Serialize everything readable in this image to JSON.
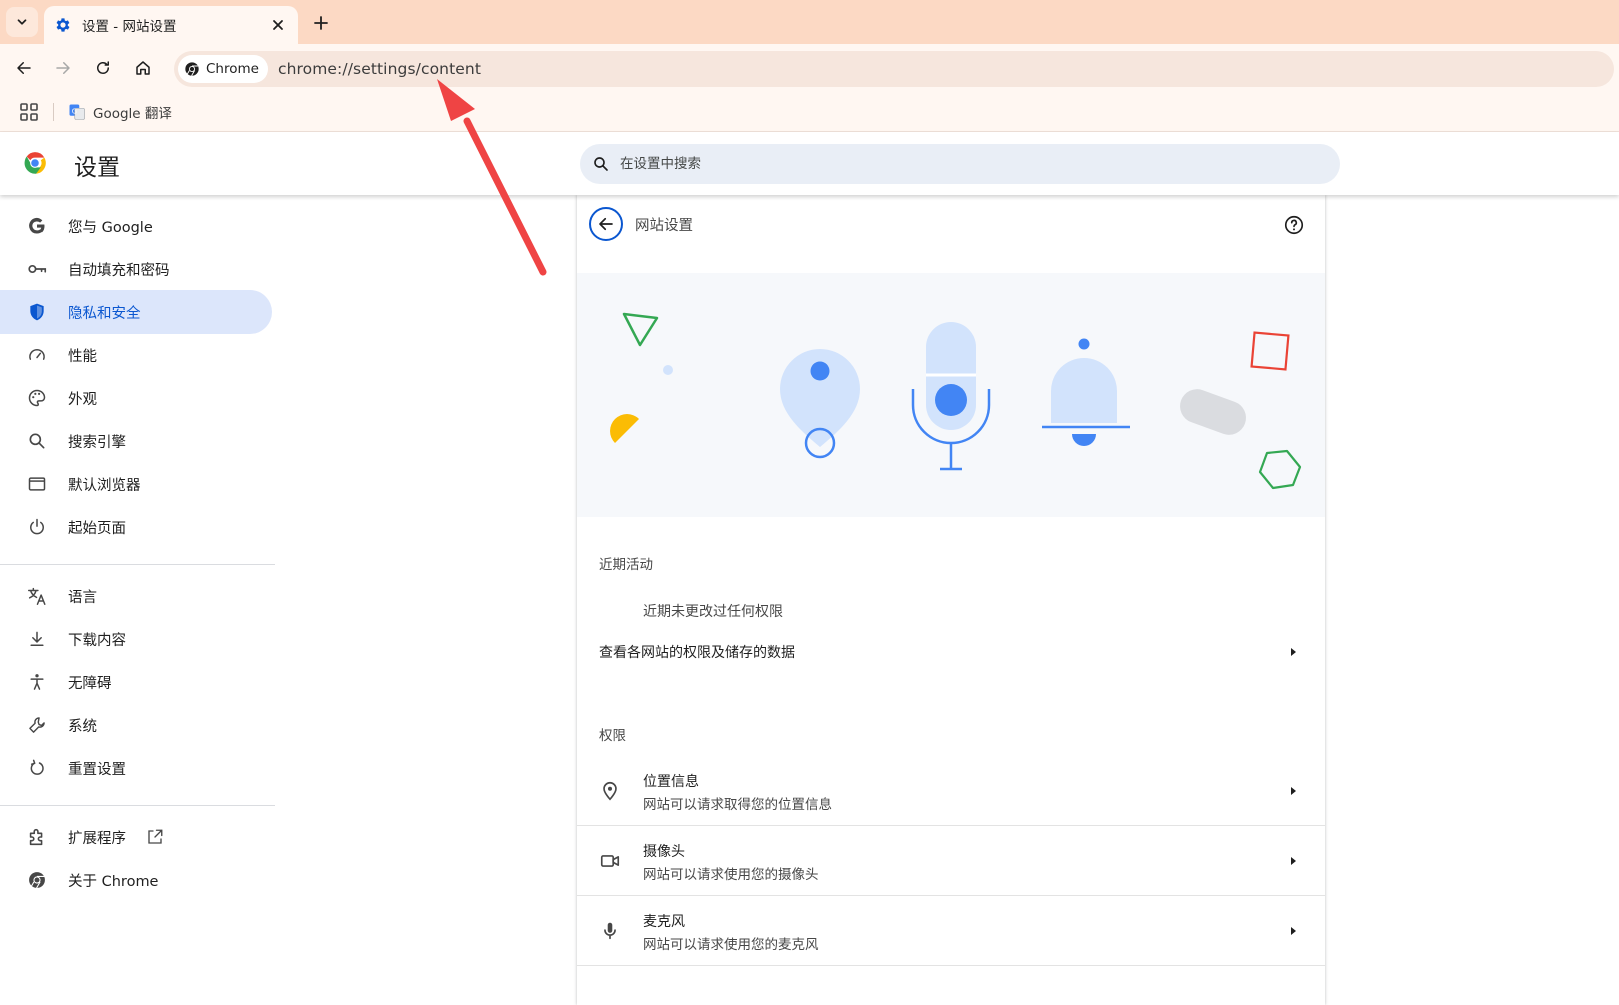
{
  "browser": {
    "tab": {
      "title": "设置 - 网站设置",
      "icon": "gear-icon"
    },
    "omnibox": {
      "chip_label": "Chrome",
      "url": "chrome://settings/content"
    },
    "bookmarks": [
      {
        "label": "Google 翻译",
        "icon": "google-translate-icon"
      }
    ]
  },
  "header": {
    "title": "设置",
    "search_placeholder": "在设置中搜索"
  },
  "sidebar": {
    "items": [
      {
        "label": "您与 Google",
        "icon": "google-g-icon"
      },
      {
        "label": "自动填充和密码",
        "icon": "key-icon"
      },
      {
        "label": "隐私和安全",
        "icon": "shield-icon",
        "active": true
      },
      {
        "label": "性能",
        "icon": "speedometer-icon"
      },
      {
        "label": "外观",
        "icon": "palette-icon"
      },
      {
        "label": "搜索引擎",
        "icon": "search-icon"
      },
      {
        "label": "默认浏览器",
        "icon": "browser-window-icon"
      },
      {
        "label": "起始页面",
        "icon": "power-icon"
      },
      {
        "label": "语言",
        "icon": "translate-icon"
      },
      {
        "label": "下载内容",
        "icon": "download-icon"
      },
      {
        "label": "无障碍",
        "icon": "accessibility-icon"
      },
      {
        "label": "系统",
        "icon": "wrench-icon"
      },
      {
        "label": "重置设置",
        "icon": "reset-icon"
      },
      {
        "label": "扩展程序",
        "icon": "puzzle-icon"
      },
      {
        "label": "关于 Chrome",
        "icon": "chrome-logo-icon"
      }
    ]
  },
  "main": {
    "title": "网站设置",
    "recent": {
      "heading": "近期活动",
      "empty_text": "近期未更改过任何权限"
    },
    "view_all_link": "查看各网站的权限及储存的数据",
    "permissions": {
      "heading": "权限",
      "rows": [
        {
          "title": "位置信息",
          "subtitle": "网站可以请求取得您的位置信息",
          "icon": "location-pin-icon"
        },
        {
          "title": "摄像头",
          "subtitle": "网站可以请求使用您的摄像头",
          "icon": "camera-icon"
        },
        {
          "title": "麦克风",
          "subtitle": "网站可以请求使用您的麦克风",
          "icon": "microphone-icon"
        }
      ]
    }
  },
  "colors": {
    "accent": "#0b57d0",
    "active_nav_bg": "#dce6fb",
    "tabstrip": "#fcd9c4",
    "annotation_arrow": "#ef4444"
  }
}
